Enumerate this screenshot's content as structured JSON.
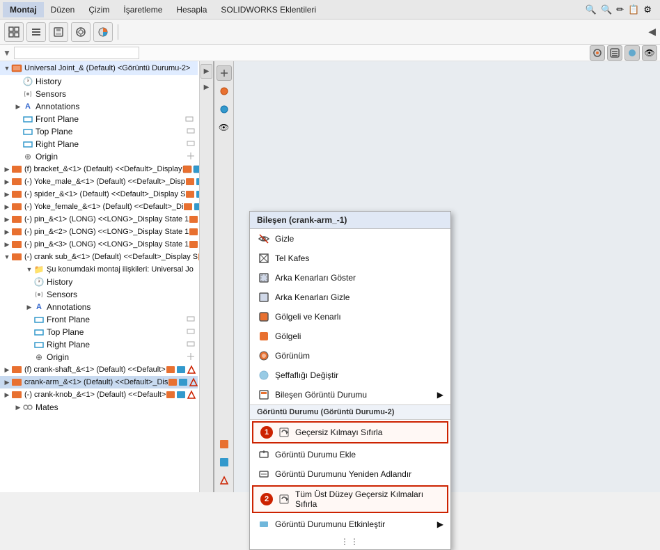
{
  "menu": {
    "items": [
      "Montaj",
      "Düzen",
      "Çizim",
      "İşaretleme",
      "Hesapla",
      "SOLIDWORKS Eklentileri"
    ]
  },
  "toolbar": {
    "icons": [
      "grid",
      "list",
      "save",
      "target",
      "pie"
    ]
  },
  "tree": {
    "root_label": "Universal Joint_& (Default) <Görüntü Durumu-2>",
    "items": [
      {
        "id": "history1",
        "label": "History",
        "icon": "history",
        "indent": 1
      },
      {
        "id": "sensors1",
        "label": "Sensors",
        "icon": "sensor",
        "indent": 1
      },
      {
        "id": "annotations1",
        "label": "Annotations",
        "icon": "annotation",
        "indent": 1
      },
      {
        "id": "frontplane1",
        "label": "Front Plane",
        "icon": "plane",
        "indent": 1
      },
      {
        "id": "topplane1",
        "label": "Top Plane",
        "icon": "plane",
        "indent": 1
      },
      {
        "id": "rightplane1",
        "label": "Right Plane",
        "icon": "plane",
        "indent": 1
      },
      {
        "id": "origin1",
        "label": "Origin",
        "icon": "origin",
        "indent": 1
      },
      {
        "id": "bracket",
        "label": "(f) bracket_&<1> (Default) <<Default>_Display",
        "icon": "comp_orange",
        "indent": 1,
        "has_right": true
      },
      {
        "id": "yoke_male",
        "label": "(-) Yoke_male_&<1> (Default) <<Default>_Disp",
        "icon": "comp_orange",
        "indent": 1,
        "has_right": true
      },
      {
        "id": "spider",
        "label": "(-) spider_&<1> (Default) <<Default>_Display S",
        "icon": "comp_orange",
        "indent": 1,
        "has_right": true
      },
      {
        "id": "yoke_female",
        "label": "(-) Yoke_female_&<1> (Default) <<Default>_Di",
        "icon": "comp_orange",
        "indent": 1,
        "has_right": true
      },
      {
        "id": "pin1",
        "label": "(-) pin_&<1> (LONG) <<LONG>_Display State 1",
        "icon": "comp_orange",
        "indent": 1,
        "has_right": true
      },
      {
        "id": "pin2",
        "label": "(-) pin_&<2> (LONG) <<LONG>_Display State 1",
        "icon": "comp_orange",
        "indent": 1,
        "has_right": true
      },
      {
        "id": "pin3",
        "label": "(-) pin_&<3> (LONG) <<LONG>_Display State 1",
        "icon": "comp_orange",
        "indent": 1,
        "has_right": true
      },
      {
        "id": "crank_sub",
        "label": "(-) crank sub_&<1> (Default) <<Default>_Display S",
        "icon": "comp_orange",
        "indent": 1,
        "has_right": true,
        "expanded": true
      },
      {
        "id": "su_konum",
        "label": "Şu konumdaki montaj ilişkileri: Universal Jo",
        "icon": "folder",
        "indent": 2
      },
      {
        "id": "history2",
        "label": "History",
        "icon": "history",
        "indent": 2
      },
      {
        "id": "sensors2",
        "label": "Sensors",
        "icon": "sensor",
        "indent": 2
      },
      {
        "id": "annotations2",
        "label": "Annotations",
        "icon": "annotation",
        "indent": 2
      },
      {
        "id": "frontplane2",
        "label": "Front Plane",
        "icon": "plane",
        "indent": 2
      },
      {
        "id": "topplane2",
        "label": "Top Plane",
        "icon": "plane",
        "indent": 2
      },
      {
        "id": "rightplane2",
        "label": "Right Plane",
        "icon": "plane",
        "indent": 2
      },
      {
        "id": "origin2",
        "label": "Origin",
        "icon": "origin",
        "indent": 2
      },
      {
        "id": "crankshaft",
        "label": "(f) crank-shaft_&<1> (Default) <<Default>",
        "icon": "comp_orange",
        "indent": 2,
        "has_right": true
      },
      {
        "id": "crankarm",
        "label": "crank-arm_&<1> (Default) <<Default>_Dis",
        "icon": "comp_orange",
        "indent": 2,
        "has_right": true,
        "selected": true
      },
      {
        "id": "crankknob",
        "label": "(-) crank-knob_&<1> (Default) <<Default>",
        "icon": "comp_orange",
        "indent": 2,
        "has_right": true
      },
      {
        "id": "mates",
        "label": "Mates",
        "icon": "mates",
        "indent": 1
      }
    ]
  },
  "context_menu": {
    "header": "Bileşen (crank-arm_-1)",
    "items": [
      {
        "id": "gizle",
        "label": "Gizle",
        "icon": "eye_off"
      },
      {
        "id": "tel_kafes",
        "label": "Tel Kafes",
        "icon": "wireframe"
      },
      {
        "id": "arka_kenar_goster",
        "label": "Arka Kenarları Göster",
        "icon": "edges_show"
      },
      {
        "id": "arka_kenar_gizle",
        "label": "Arka Kenarları Gizle",
        "icon": "edges_hide"
      },
      {
        "id": "golgeli_kenarli",
        "label": "Gölgeli ve Kenarlı",
        "icon": "shaded_edges"
      },
      {
        "id": "golgeli",
        "label": "Gölgeli",
        "icon": "shaded"
      },
      {
        "id": "gorunum",
        "label": "Görünüm",
        "icon": "appearance"
      },
      {
        "id": "seffafligi_degistir",
        "label": "Şeffaflığı Değiştir",
        "icon": "transparency"
      },
      {
        "id": "bilesen_goruntu",
        "label": "Bileşen Görüntü Durumu",
        "icon": "comp_view",
        "has_arrow": true
      }
    ],
    "section1_label": "Görüntü Durumu (Görüntü Durumu-2)",
    "highlighted_items": [
      {
        "id": "gecersiz_sifirla",
        "label": "Geçersiz Kılmayı Sıfırla",
        "icon": "reset",
        "badge": "1"
      },
      {
        "id": "goruntu_ekle",
        "label": "Görüntü Durumu Ekle",
        "icon": "add_view"
      },
      {
        "id": "goruntu_yeniden",
        "label": "Görüntü Durumunu Yeniden Adlandır",
        "icon": "rename"
      },
      {
        "id": "tum_ust_gecersiz",
        "label": "Tüm Üst Düzey Geçersiz Kılmaları Sıfırla",
        "icon": "reset_all",
        "badge": "2"
      },
      {
        "id": "goruntu_etkinlestir",
        "label": "Görüntü Durumunu Etkinleştir",
        "icon": "activate",
        "has_arrow": true
      }
    ],
    "more_icon": "⋮⋮"
  },
  "icons": {
    "search": "🔍",
    "gear": "⚙",
    "history": "🕐",
    "sensor": "📡",
    "annotation": "A",
    "plane": "◻",
    "origin": "⊕",
    "component": "■",
    "folder": "📁",
    "expand": "▶",
    "collapse": "▼",
    "right_arrow": "▶",
    "eye_off": "👁",
    "wireframe": "⬡",
    "reset": "↺",
    "add": "+",
    "more": "…"
  },
  "top_right_icons": [
    "🔍",
    "🔍",
    "✏",
    "📋",
    "⚙"
  ]
}
